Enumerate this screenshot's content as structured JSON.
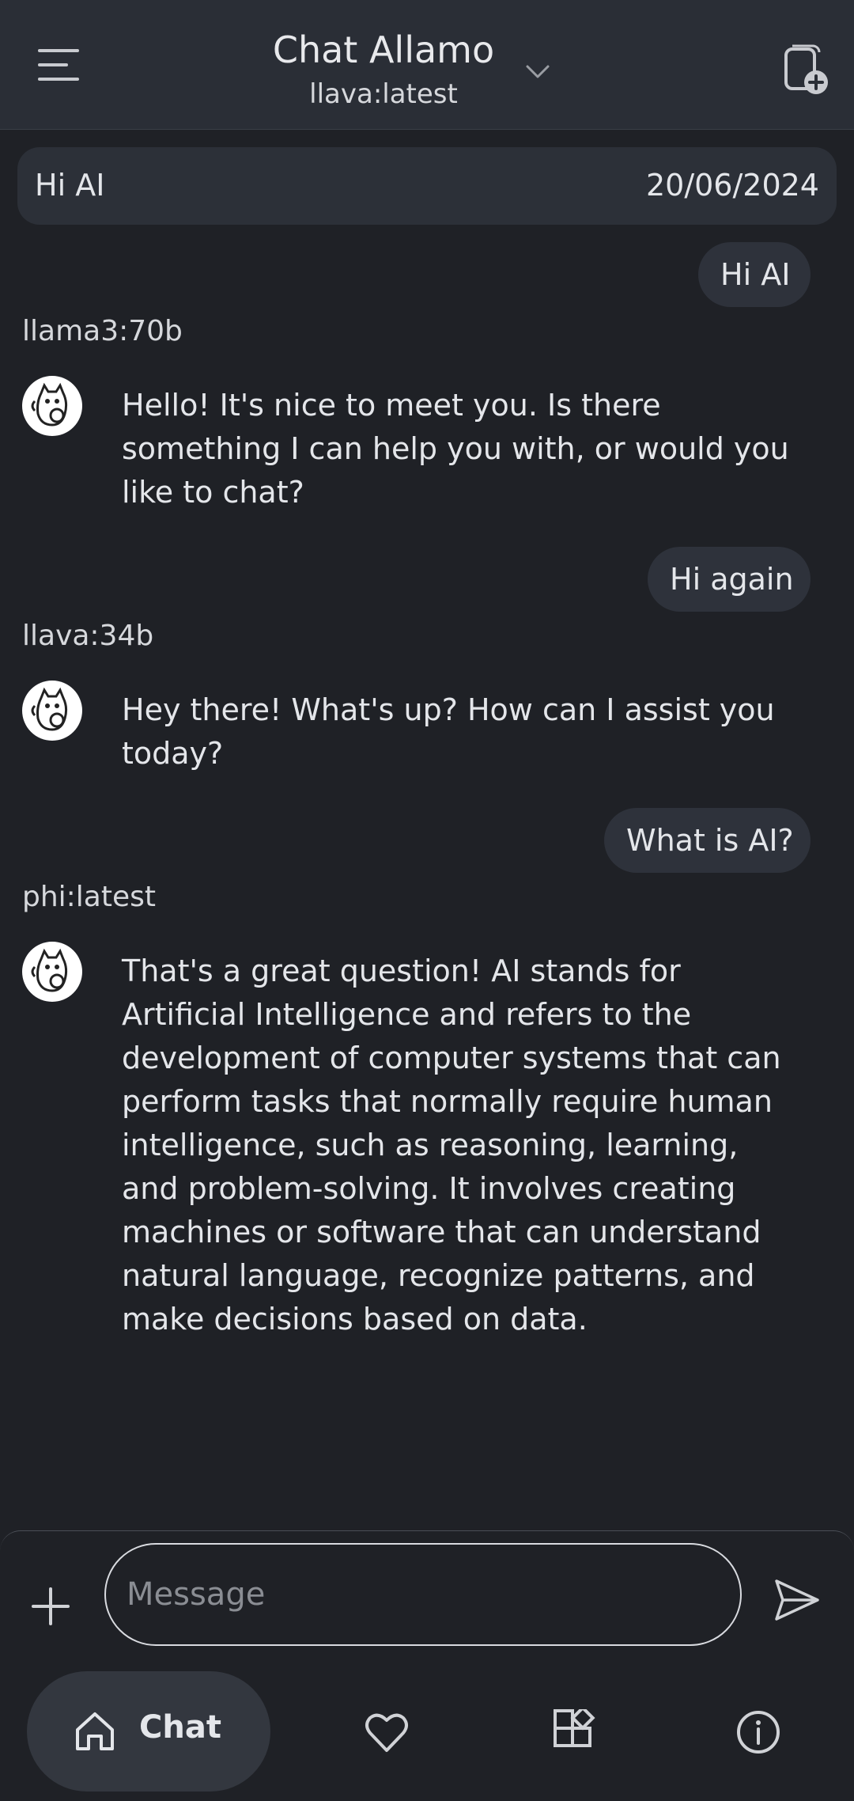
{
  "header": {
    "title": "Chat Allamo",
    "model": "llava:latest",
    "icons": {
      "menu": "menu-icon",
      "model_dropdown": "chevron-down-icon",
      "new_chat": "new-chat-icon"
    }
  },
  "chat_banner": {
    "title": "Hi AI",
    "date": "20/06/2024"
  },
  "conversation": [
    {
      "user": "Hi AI",
      "model": "llama3:70b",
      "reply": "Hello! It's nice to meet you. Is there something I can help you with, or would you like to chat?"
    },
    {
      "user": "Hi again",
      "model": "llava:34b",
      "reply": "Hey there! What's up? How can I assist you today?"
    },
    {
      "user": "What is AI?",
      "model": "phi:latest",
      "reply": "That's a great question! AI stands for Artificial Intelligence and refers to the development of computer systems that can perform tasks that normally require human intelligence, such as reasoning, learning, and problem-solving. It involves creating machines or software that can understand natural language, recognize patterns, and make decisions based on data."
    }
  ],
  "composer": {
    "placeholder": "Message",
    "value": "",
    "icons": {
      "attach": "plus-icon",
      "send": "send-icon"
    }
  },
  "bottom_nav": {
    "items": [
      {
        "label": "Chat",
        "icon": "home-icon",
        "active": true
      },
      {
        "icon": "heart-icon"
      },
      {
        "icon": "widgets-icon"
      },
      {
        "icon": "info-icon"
      }
    ]
  },
  "colors": {
    "background": "#1f2126",
    "header": "#2a2e36",
    "bubble": "#2e323b",
    "text": "#e4e6ea"
  }
}
